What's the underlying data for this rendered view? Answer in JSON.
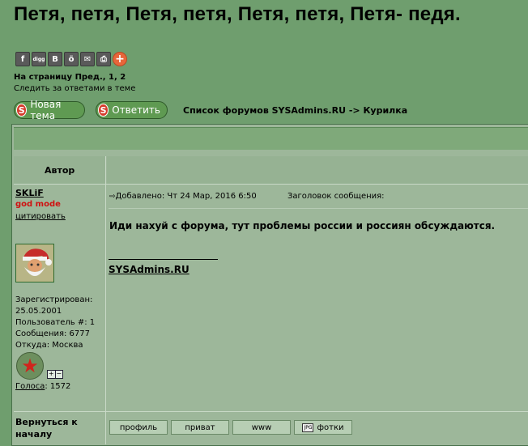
{
  "topic_title": "Петя, петя, Петя, петя, Петя, петя, Петя- педя.",
  "share_icons": [
    {
      "icon": "facebook-icon",
      "glyph": "f"
    },
    {
      "icon": "digg-icon",
      "glyph": "digg"
    },
    {
      "icon": "vkontakte-icon",
      "glyph": "B"
    },
    {
      "icon": "odnoklassniki-icon",
      "glyph": "ö"
    },
    {
      "icon": "email-icon",
      "glyph": "✉"
    },
    {
      "icon": "print-icon",
      "glyph": "⎙"
    },
    {
      "icon": "more-share-icon",
      "glyph": "+"
    }
  ],
  "pagination": {
    "prefix": "На страницу",
    "prev": "Пред.",
    "page1": "1",
    "page2": "2"
  },
  "follow_link": "Следить за ответами в теме",
  "buttons": {
    "new_topic": "Новая тема",
    "reply": "Ответить",
    "s_glyph": "S"
  },
  "breadcrumb": "Список форумов SYSAdmins.RU -> Курилка",
  "column_author": "Автор",
  "post": {
    "username": "SKLiF",
    "rank": "god mode",
    "quote": "цитировать",
    "registered_label": "Зарегистрирован:",
    "registered_date": "25.05.2001",
    "user_number": "Пользователь #: 1",
    "messages": "Сообщения: 6777",
    "location": "Откуда: Москва",
    "votes_label": "Голоса",
    "votes_count": ": 1572",
    "added": "Добавлено: Чт 24 Мар, 2016 6:50",
    "subject_label": "Заголовок сообщения:",
    "text": "Иди нахуй с форума, тут проблемы россии и россиян обсуждаются.",
    "signature": "SYSAdmins.RU"
  },
  "back_to_top": "Вернуться к началу",
  "profile_buttons": {
    "profile": "профиль",
    "private": "приват",
    "www": "www",
    "photos": "фотки"
  },
  "colors": {
    "background": "#6f9e6e",
    "panel": "#9db79a",
    "rank_red": "#d01010",
    "button_green": "#5f9a52"
  }
}
